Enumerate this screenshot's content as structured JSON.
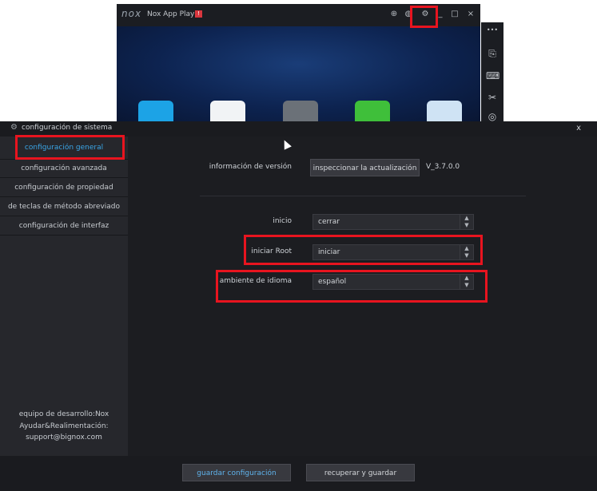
{
  "nox": {
    "logo": "nox",
    "title": "Nox App Player",
    "badge": "!",
    "controls": {
      "pin": "⊕",
      "volume": "◍",
      "settings": "⚙",
      "minimize": "_",
      "maximize": "□",
      "close": "×"
    },
    "side_icons": {
      "more": "•••",
      "shake": "⎘",
      "keyboard": "⌨",
      "scissors": "✂",
      "record": "◎"
    },
    "apps": [
      "browser",
      "play-store",
      "google-settings",
      "game-center",
      "file-manager"
    ]
  },
  "dialog": {
    "title": "configuración de sistema",
    "close_label": "x",
    "sidebar": {
      "items": [
        {
          "label": "configuración general",
          "active": true
        },
        {
          "label": "configuración avanzada",
          "active": false
        },
        {
          "label": "configuración de propiedad",
          "active": false
        },
        {
          "label": "de teclas de método abreviado",
          "active": false
        },
        {
          "label": "configuración de interfaz",
          "active": false
        }
      ],
      "footer": [
        "equipo de desarrollo:Nox",
        "Ayudar&Realimentación:",
        "support@bignox.com"
      ]
    },
    "main": {
      "version_label": "información de versión",
      "update_button": "inspeccionar la actualización",
      "version_value": "V_3.7.0.0",
      "settings": [
        {
          "label": "inicio",
          "value": "cerrar"
        },
        {
          "label": "iniciar Root",
          "value": "iniciar"
        },
        {
          "label": "ambiente de idioma",
          "value": "español"
        }
      ]
    },
    "footer": {
      "save_button": "guardar configuración",
      "restore_button": "recuperar y guardar"
    }
  },
  "colors": {
    "highlight_box": "#e8141f",
    "active_item": "#3aa6e8",
    "dialog_bg": "#1c1d21"
  }
}
